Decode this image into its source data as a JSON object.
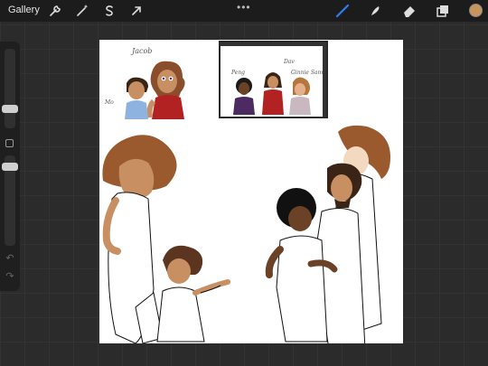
{
  "topbar": {
    "gallery_label": "Gallery",
    "actions_icon": "wrench-icon",
    "adjustments_icon": "magic-wand-icon",
    "selection_icon": "selection-s-icon",
    "transform_icon": "arrow-cursor-icon",
    "more_glyph": "•••",
    "brush_icon": "brush-icon",
    "smudge_icon": "smudge-icon",
    "eraser_icon": "eraser-icon",
    "layers_icon": "layers-icon",
    "current_color": "#c9955e"
  },
  "sidebar": {
    "brush_size_level": 0.52,
    "opacity_level": 0.35,
    "undo_icon": "undo-icon",
    "redo_icon": "redo-icon"
  },
  "canvas": {
    "labels": {
      "top_name_1": "Jacob",
      "top_name_2": "Mo",
      "pasted_name_1": "Peng",
      "pasted_name_2": "Dav",
      "pasted_name_3": "Ginnie Sam"
    }
  },
  "colors": {
    "brand_blue": "#2f7ef0",
    "canvas_bg": "#ffffff",
    "app_bg": "#2b2b2b"
  }
}
